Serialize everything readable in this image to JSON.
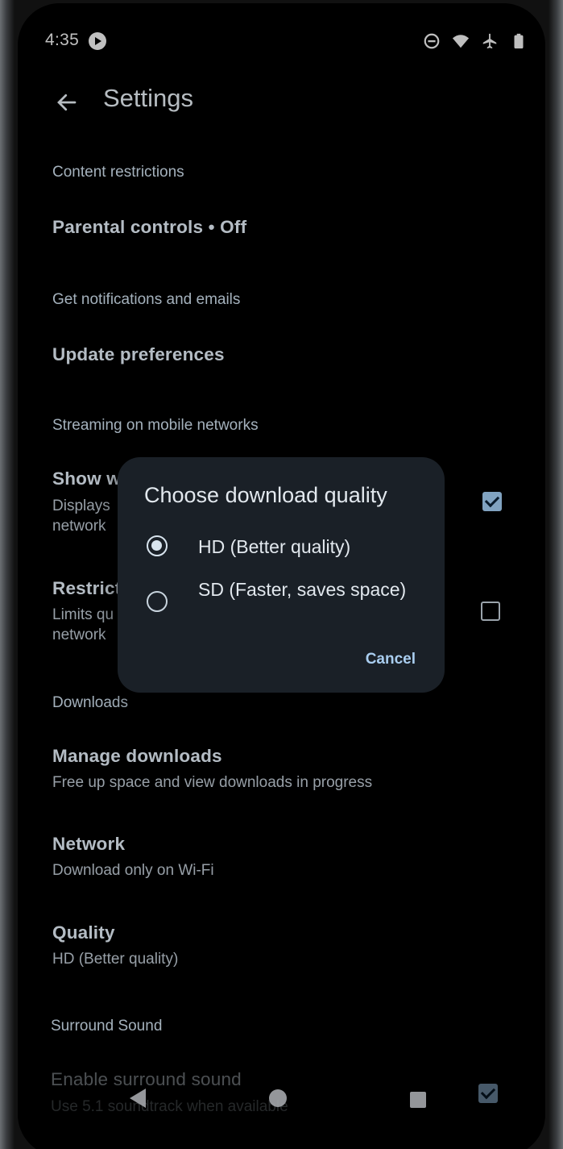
{
  "status_bar": {
    "time": "4:35",
    "icons": [
      "do-not-disturb-icon",
      "wifi-icon",
      "airplane-icon",
      "battery-icon"
    ]
  },
  "app_bar": {
    "title": "Settings"
  },
  "sections": {
    "content_restrictions": {
      "header": "Content restrictions",
      "parental_controls": "Parental controls • Off"
    },
    "notifications": {
      "header": "Get notifications and emails",
      "update_preferences": "Update preferences"
    },
    "streaming": {
      "header": "Streaming on mobile networks",
      "show_title": "Show w",
      "show_sub_1": "Displays",
      "show_sub_2": "network",
      "show_checked": true,
      "restrict_title": "Restrict",
      "restrict_sub_1": "Limits qu",
      "restrict_sub_2": "network",
      "restrict_checked": false
    },
    "downloads": {
      "header": "Downloads",
      "manage_title": "Manage downloads",
      "manage_sub": "Free up space and view downloads in progress",
      "network_title": "Network",
      "network_sub": "Download only on Wi-Fi",
      "quality_title": "Quality",
      "quality_sub": "HD (Better quality)"
    },
    "surround": {
      "header": "Surround Sound",
      "enable_title": "Enable surround sound",
      "enable_sub": "Use 5.1 soundtrack when available",
      "enable_checked": true
    }
  },
  "dialog": {
    "title": "Choose download quality",
    "options": [
      {
        "label": "HD (Better quality)",
        "selected": true
      },
      {
        "label": "SD (Faster, saves space)",
        "selected": false
      }
    ],
    "cancel_label": "Cancel"
  },
  "colors": {
    "background": "#000000",
    "dialog_bg": "#1a2027",
    "accent": "#a9cdef",
    "checkbox_checked": "#9ec7ec"
  }
}
